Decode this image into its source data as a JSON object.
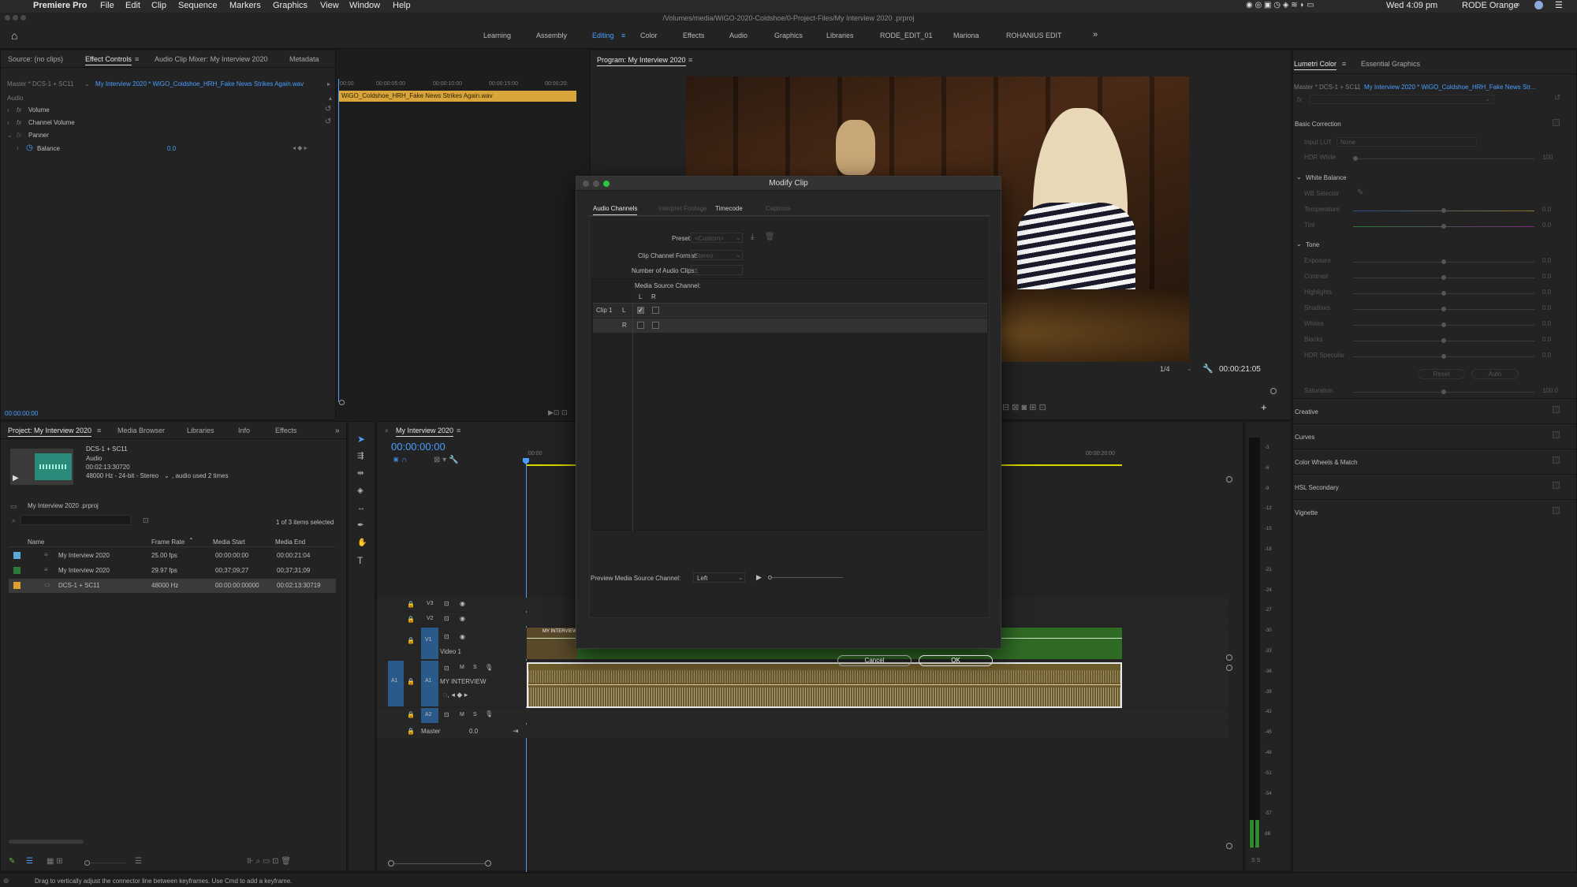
{
  "menubar": {
    "app": "Premiere Pro",
    "items": [
      "File",
      "Edit",
      "Clip",
      "Sequence",
      "Markers",
      "Graphics",
      "View",
      "Window",
      "Help"
    ],
    "clock": "Wed 4:09 pm",
    "user": "RODE Orange"
  },
  "titlebar": {
    "path": "/Volumes/media/WiGO-2020-Coldshoe/0-Project-Files/My Interview 2020 .prproj"
  },
  "workspaces": [
    "Learning",
    "Assembly",
    "Editing",
    "Color",
    "Effects",
    "Audio",
    "Graphics",
    "Libraries",
    "RODE_EDIT_01",
    "Mariona",
    "ROHANIUS EDIT"
  ],
  "active_workspace": "Editing",
  "source_panel": {
    "tabs": [
      "Source: (no clips)",
      "Effect Controls",
      "Audio Clip Mixer: My Interview 2020",
      "Metadata"
    ],
    "master_label": "Master * DCS-1 + SC11",
    "clip_link": "My Interview 2020 * WiGO_Coldshoe_HRH_Fake News Strikes Again.wav",
    "ruler": [
      "00:00",
      "00:00:05:00",
      "00:00:10:00",
      "00:00:15:00",
      "00:00:20:"
    ],
    "clip_bar": "WiGO_Coldshoe_HRH_Fake News Strikes Again.wav",
    "section": "Audio",
    "effects": [
      "Volume",
      "Channel Volume",
      "Panner"
    ],
    "balance_label": "Balance",
    "balance_value": "0.0",
    "timecode": "00:00:00:00"
  },
  "program_monitor": {
    "title": "Program: My Interview 2020",
    "zoom": "1/4",
    "timecode": "00:00:21:05"
  },
  "lumetri": {
    "tabs": [
      "Lumetri Color",
      "Essential Graphics"
    ],
    "master_label": "Master * DCS-1 + SC11",
    "clip_link": "My Interview 2020 * WiGO_Coldshoe_HRH_Fake News Str...",
    "basic_correction": "Basic Correction",
    "input_lut_label": "Input LUT",
    "input_lut_value": "None",
    "hdr_white_label": "HDR White",
    "hdr_white_value": "100",
    "white_balance": "White Balance",
    "wb_selector": "WB Selector",
    "temperature": "Temperature",
    "tint": "Tint",
    "tone": "Tone",
    "tone_items": [
      "Exposure",
      "Contrast",
      "Highlights",
      "Shadows",
      "Whites",
      "Blacks",
      "HDR Specular"
    ],
    "zero": "0.0",
    "reset": "Reset",
    "auto": "Auto",
    "saturation": "Saturation",
    "saturation_value": "100.0",
    "sections": [
      "Creative",
      "Curves",
      "Color Wheels & Match",
      "HSL Secondary",
      "Vignette"
    ]
  },
  "project_panel": {
    "tabs": [
      "Project: My Interview 2020",
      "Media Browser",
      "Libraries",
      "Info",
      "Effects"
    ],
    "clip_name": "DCS-1 + SC11",
    "clip_type": "Audio",
    "clip_duration": "00:02:13:30720",
    "clip_format": "48000 Hz - 24-bit - Stereo",
    "clip_usage": ", audio used 2 times",
    "project_file": "My Interview 2020 .prproj",
    "selected_count": "1 of 3 items selected",
    "columns": [
      "Name",
      "Frame Rate",
      "Media Start",
      "Media End"
    ],
    "rows": [
      {
        "name": "My Interview 2020",
        "rate": "25.00 fps",
        "start": "00:00:00:00",
        "end": "00:00:21:04",
        "color": "#5aa9d6"
      },
      {
        "name": "My Interview 2020",
        "rate": "29.97 fps",
        "start": "00;37;09;27",
        "end": "00;37;31;09",
        "color": "#2e7a3a"
      },
      {
        "name": "DCS-1 + SC11",
        "rate": "48000 Hz",
        "start": "00:00:00:00000",
        "end": "00:02:13:30719",
        "color": "#e0a030"
      }
    ]
  },
  "timeline": {
    "title": "My Interview 2020",
    "timecode": "00:00:00:00",
    "ruler": [
      ":00:00",
      "00:00:20:00"
    ],
    "tracks": {
      "v3": "V3",
      "v2": "V2",
      "v1": "V1",
      "video1": "Video 1",
      "a1": "A1",
      "a1name": "MY INTERVIEW",
      "a2": "A2",
      "master": "Master",
      "master_value": "0.0"
    },
    "clip_label": "MY INTERVIEW",
    "track_btns": {
      "m": "M",
      "s": "S"
    }
  },
  "meters": [
    "-3",
    "-6",
    "-9",
    "-12",
    "-15",
    "-18",
    "-21",
    "-24",
    "-27",
    "-30",
    "-33",
    "-36",
    "-39",
    "-42",
    "-45",
    "-48",
    "-51",
    "-54",
    "-57",
    "dB"
  ],
  "meter_bottom": "S S",
  "dialog": {
    "title": "Modify Clip",
    "tabs": [
      "Audio Channels",
      "Interpret Footage",
      "Timecode",
      "Captions"
    ],
    "preset_label": "Preset:",
    "preset_value": "<Custom>",
    "format_label": "Clip Channel Format:",
    "format_value": "Stereo",
    "num_label": "Number of Audio Clips:",
    "num_value": "1",
    "source_channel": "Media Source Channel:",
    "col_l": "L",
    "col_r": "R",
    "clip1": "Clip 1",
    "row_l": "L",
    "row_r": "R",
    "preview_label": "Preview Media Source Channel:",
    "preview_value": "Left",
    "cancel": "Cancel",
    "ok": "OK"
  },
  "status_bar": "Drag to vertically adjust the connector line between keyframes. Use Cmd to add a keyframe."
}
